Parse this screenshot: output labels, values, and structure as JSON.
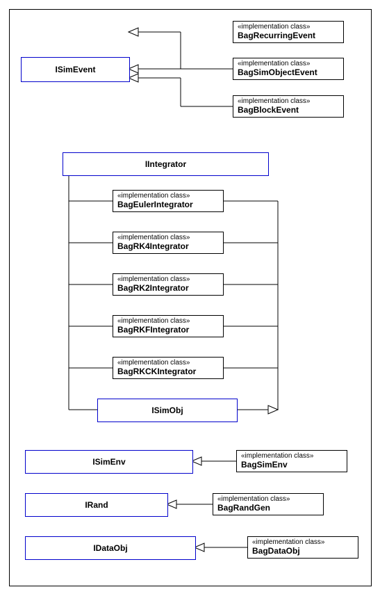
{
  "stereotype": "«implementation class»",
  "interfaces": {
    "isimEvent": "ISimEvent",
    "iIntegrator": "IIntegrator",
    "iSimObj": "ISimObj",
    "iSimEnv": "ISimEnv",
    "iRand": "IRand",
    "iDataObj": "IDataObj"
  },
  "impls": {
    "bagRecurringEvent": "BagRecurringEvent",
    "bagSimObjectEvent": "BagSimObjectEvent",
    "bagBlockEvent": "BagBlockEvent",
    "bagEulerIntegrator": "BagEulerIntegrator",
    "bagRK4Integrator": "BagRK4Integrator",
    "bagRK2Integrator": "BagRK2Integrator",
    "bagRKFIntegrator": "BagRKFIntegrator",
    "bagRKCKIntegrator": "BagRKCKIntegrator",
    "bagSimEnv": "BagSimEnv",
    "bagRandGen": "BagRandGen",
    "bagDataObj": "BagDataObj"
  }
}
